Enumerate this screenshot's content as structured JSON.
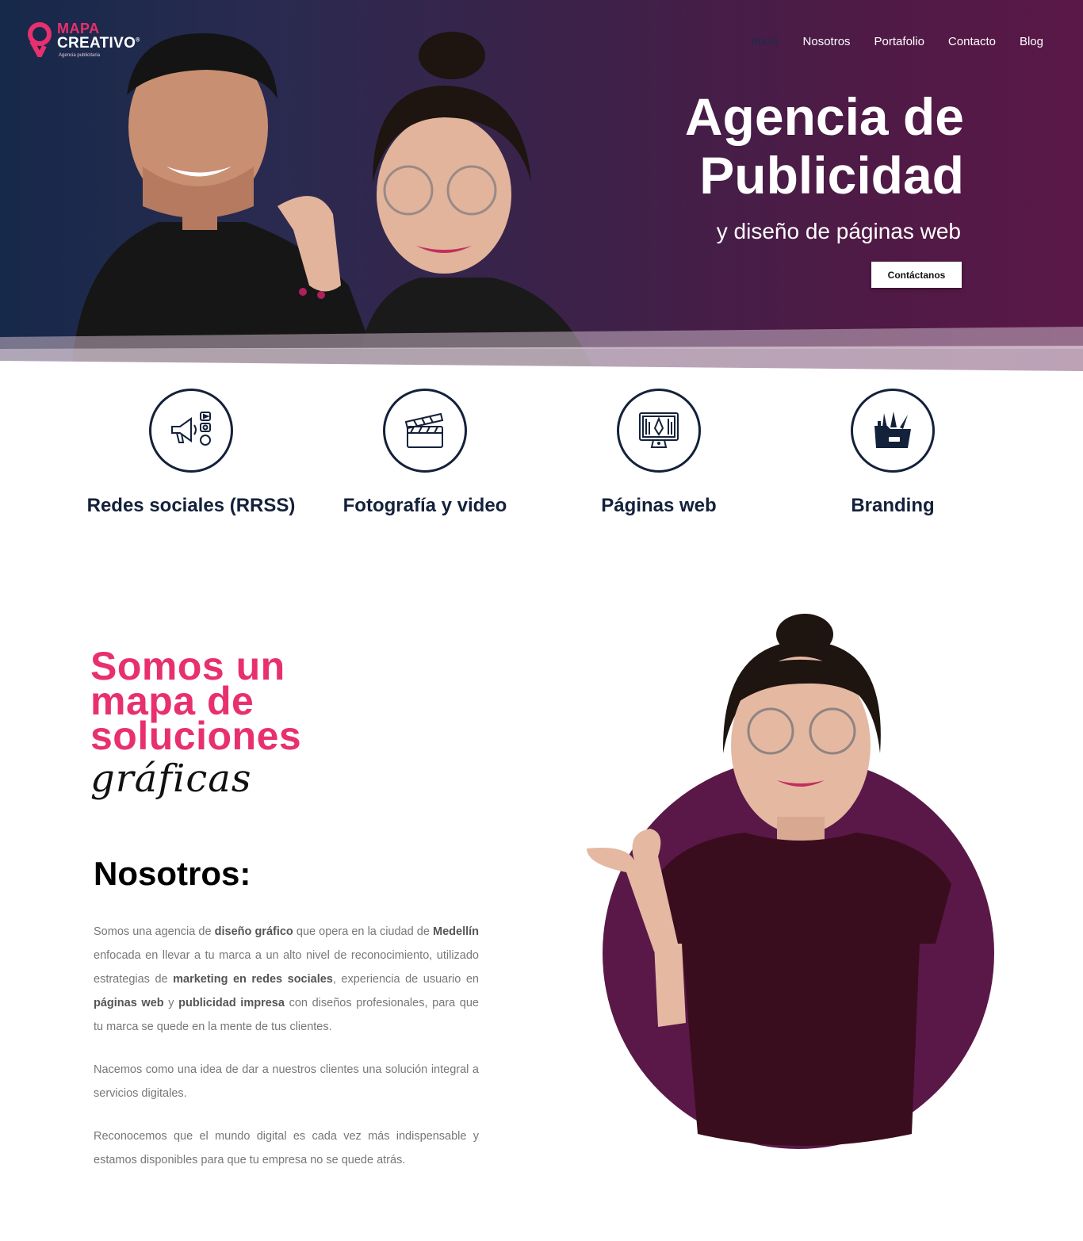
{
  "brand": {
    "line1": "MAPA",
    "line2": "CREATIVO",
    "registered": "®",
    "tagline": "Agencia publicitaria",
    "accent_color": "#e8306e",
    "dark_color": "#14213a"
  },
  "nav": {
    "items": [
      {
        "label": "Inicio",
        "active": true
      },
      {
        "label": "Nosotros"
      },
      {
        "label": "Portafolio"
      },
      {
        "label": "Contacto"
      },
      {
        "label": "Blog"
      }
    ]
  },
  "hero": {
    "title_line1": "Agencia de",
    "title_line2": "Publicidad",
    "subtitle": "y diseño de páginas web",
    "cta_label": "Contáctanos"
  },
  "services": [
    {
      "label": "Redes sociales (RRSS)",
      "icon": "megaphone-social-icon"
    },
    {
      "label": "Fotografía y video",
      "icon": "clapperboard-icon"
    },
    {
      "label": "Páginas web",
      "icon": "web-design-monitor-icon"
    },
    {
      "label": "Branding",
      "icon": "branding-folder-icon"
    }
  ],
  "about": {
    "slogan_line1": "Somos un",
    "slogan_line2": "mapa de",
    "slogan_line3": "soluciones",
    "slogan_script": "gráficas",
    "title": "Nosotros:",
    "p1": {
      "t1": "Somos una agencia de ",
      "b1": "diseño gráfico",
      "t2": " que opera en la ciudad de ",
      "b2": "Medellín",
      "t3": " enfocada en llevar a tu marca a un alto nivel de reconocimiento, utilizado estrategias de ",
      "b3": "marketing en redes sociales",
      "t4": ", experiencia de usuario en ",
      "b4": "páginas web",
      "t5": " y ",
      "b5": "publicidad impresa",
      "t6": " con diseños profesionales, para que tu marca se quede en la mente de tus clientes."
    },
    "p2": "Nacemos como una idea de dar a nuestros clientes una solución integral a servicios digitales.",
    "p3": "Reconocemos que el mundo digital es cada vez más indispensable y estamos disponibles para que tu empresa no se quede atrás."
  }
}
